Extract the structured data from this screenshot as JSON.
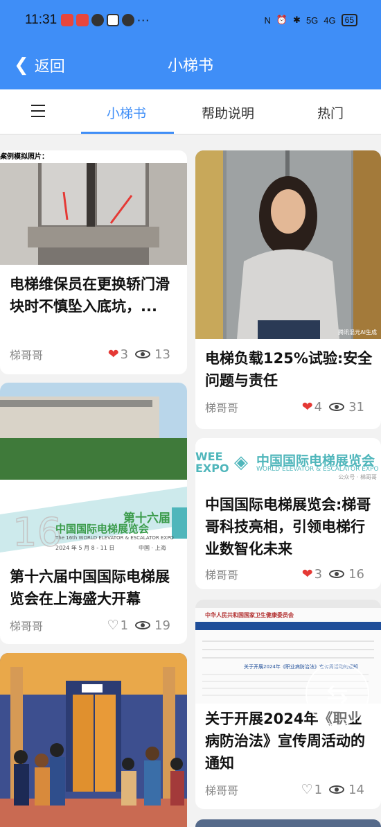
{
  "status": {
    "time": "11:31",
    "battery": "65",
    "signal1": "5G",
    "signal2": "4G"
  },
  "header": {
    "back_label": "返回",
    "title": "小梯书"
  },
  "tabs": [
    {
      "label": "小梯书",
      "active": true
    },
    {
      "label": "帮助说明",
      "active": false
    },
    {
      "label": "热门",
      "active": false
    }
  ],
  "cards": [
    {
      "img_caption": "案例模拟照片：",
      "title": "电梯维保员在更换轿门滑块时不慎坠入底坑，...",
      "author": "梯哥哥",
      "likes": "3",
      "liked": true,
      "views": "13"
    },
    {
      "img_caption": "",
      "title": "第十六届中国国际电梯展览会在上海盛大开幕",
      "author": "梯哥哥",
      "likes": "1",
      "liked": false,
      "views": "19",
      "poster_line1": "第十六届",
      "poster_line2": "中国国际电梯展览会",
      "poster_line3": "The 16th WORLD ELEVATOR & ESCALATOR EXPO",
      "poster_line4": "2024 年 5 月 8 - 11 日",
      "poster_line5": "中国 · 上海"
    },
    {
      "img_caption": "",
      "title": "电梯负载125%试验:安全问题与责任",
      "author": "梯哥哥",
      "likes": "4",
      "liked": true,
      "views": "31",
      "watermark": "腾讯混元AI生成"
    },
    {
      "img_caption": "",
      "title": "中国国际电梯展览会:梯哥哥科技亮相，引领电梯行业数智化未来",
      "author": "梯哥哥",
      "likes": "3",
      "liked": true,
      "views": "16",
      "banner_logo": "WEE EXPO",
      "banner_cn": "中国国际电梯展览会",
      "banner_en": "WORLD ELEVATOR & ESCALATOR EXPO",
      "banner_src": "公众号 · 梯哥哥"
    },
    {
      "img_caption": "",
      "title": "关于开展2024年《职业病防治法》宣传周活动的通知",
      "author": "梯哥哥",
      "likes": "1",
      "liked": false,
      "views": "14",
      "doc_header": "中华人民共和国国家卫生健康委员会",
      "doc_title": "关于开展2024年《职业病防治法》宣传周活动的通知"
    }
  ],
  "colors": {
    "primary": "#3f8ef7",
    "like": "#e53935"
  }
}
